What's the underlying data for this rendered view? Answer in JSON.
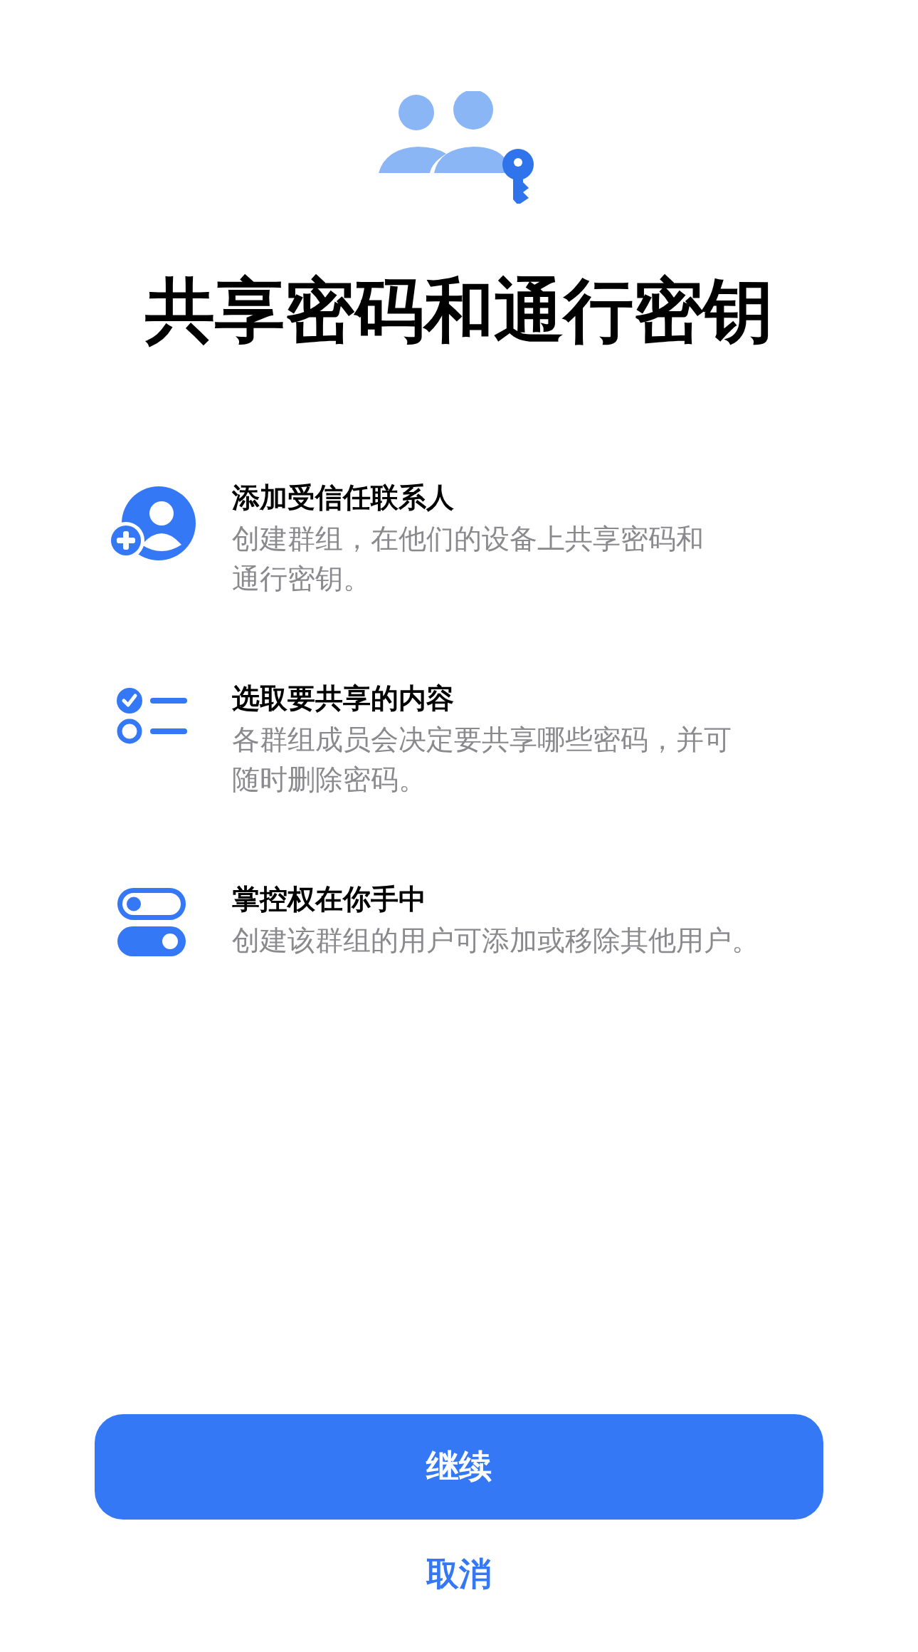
{
  "title": "共享密码和通行密钥",
  "features": [
    {
      "kind": "add-contact",
      "title": "添加受信任联系人",
      "description": "创建群组，在他们的设备上共享密码和通行密钥。"
    },
    {
      "kind": "checklist",
      "title": "选取要共享的内容",
      "description": "各群组成员会决定要共享哪些密码，并可随时删除密码。"
    },
    {
      "kind": "toggles",
      "title": "掌控权在你手中",
      "description": "创建该群组的用户可添加或移除其他用户。"
    }
  ],
  "primary_button": "继续",
  "secondary_button": "取消"
}
